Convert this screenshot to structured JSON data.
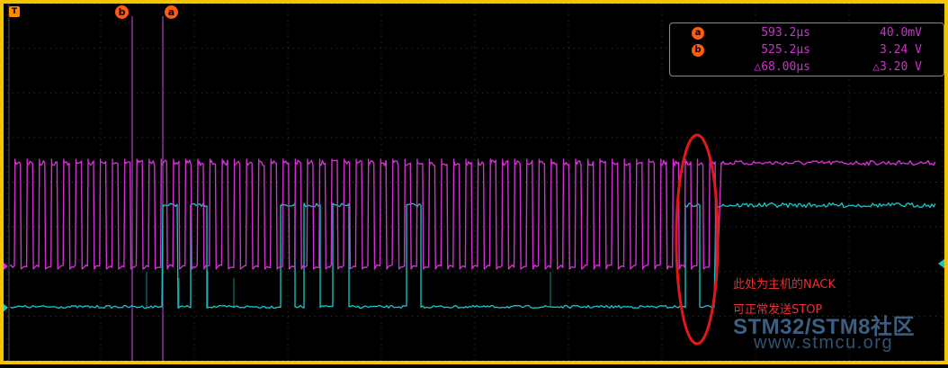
{
  "cursors": {
    "a": {
      "label": "a",
      "time": "593.2µs",
      "voltage": "40.0mV"
    },
    "b": {
      "label": "b",
      "time": "525.2µs",
      "voltage": "3.24 V"
    },
    "delta": {
      "time": "△68.00µs",
      "voltage": "△3.20 V"
    }
  },
  "trigger_label": "T",
  "annotation": {
    "line1": "此处为主机的NACK",
    "line2": "可正常发送STOP"
  },
  "watermark": {
    "line1": "STM32/STM8社区",
    "line2": "www.stmcu.org"
  },
  "colors": {
    "frame": "#f5c400",
    "ch1_scl": "#d030d0",
    "ch2_sda": "#18c8c8",
    "cursor": "#b040c0",
    "marker": "#ff5a14",
    "annotation": "#e83030",
    "grid": "#3a3a3a"
  }
}
